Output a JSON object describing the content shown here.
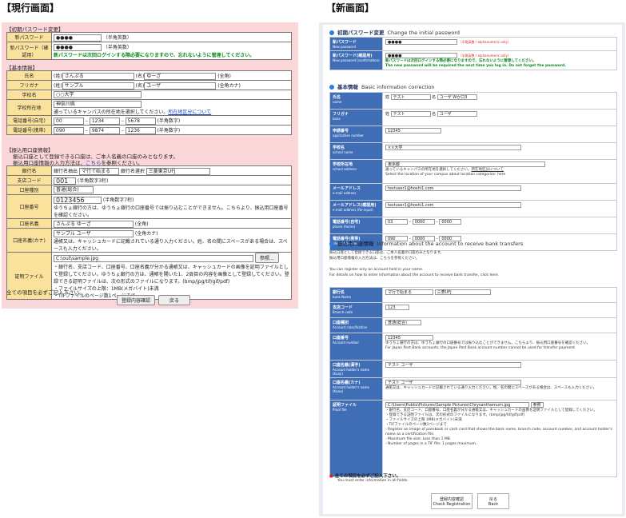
{
  "left_header": "【現行画面】",
  "right_header": "【新画面】",
  "old": {
    "sec1": "【初期パスワード変更】",
    "pw_label": "新パスワード",
    "pw_value": "●●●●",
    "pw_hint": "（半角英数）",
    "pw2_label": "新パスワード（確認用）",
    "pw2_value": "●●●●",
    "pw2_hint": "（半角英数）",
    "pw_note": "新パスワードは次回ログインする際必要になりますので、忘れないように管理してください。",
    "sec2": "【基本情報】",
    "name_label": "氏名",
    "sei_l": "(姓)",
    "sei": "さんぷる",
    "mei_l": "(名)",
    "mei": "ゆーざ",
    "zen": "(全角)",
    "kana_label": "フリガナ",
    "kana_sei": "サンプル",
    "kana_mei": "ユーザ",
    "zenkana": "(全角カナ)",
    "school_label": "学校名",
    "school": "○○大学",
    "campus_label": "学校所在地",
    "campus": "神奈川県",
    "campus_note": "通っているキャンパスの所在地を選択してください。",
    "campus_link": "所在地区分について",
    "tel_label": "電話番号(自宅)",
    "tel": [
      "00",
      "1234",
      "5678"
    ],
    "han": "(半角数字)",
    "mob_label": "電話番号(携帯)",
    "mob": [
      "090",
      "9874",
      "1236"
    ],
    "sec3": "【振込用口座情報】",
    "bank_note1": "振込口座として登録できる口座は、ご本人名義の口座のみとなります。",
    "bank_note2": "振込用口座情報の入力方法は、",
    "bank_note2_link": "こちら",
    "bank_note2_end": "を参照ください。",
    "bank_label": "銀行名",
    "bank_filter_l": "銀行名抽出",
    "bank_filter": "マ行で始まる",
    "bank_sel_l": "銀行名選択",
    "bank_sel": "三菱東京UFJ",
    "branch_label": "支店コード",
    "branch": "001",
    "branch_hint": "(半角数字3桁)",
    "type_label": "口座種別",
    "type": "普通(総合)",
    "acct_label": "口座番号",
    "acct": "0123456",
    "acct_hint": "(半角数字7桁)",
    "acct_note": "ゆうちょ銀行の方は、ゆうちょ銀行の口座番号では振り込むことができません。こちらより、振込用口座番号を確認ください。",
    "holder_label": "口座名義",
    "holder": "さんぷる ゆーざ",
    "holder_hint": "(全角)",
    "holder_kana_label": "口座名義(カナ)",
    "holder_kana": "サンプル ユーザ",
    "holder_kana_hint": "(全角カナ)",
    "holder_kana_note": "通帳又は、キャッシュカードに記載されている通り入力ください。姓、名の間にスペースがある場合は、スペースも入力ください。",
    "proof_label": "証明ファイル",
    "proof": "C:\\out\\sample.jpg",
    "browse": "参照...",
    "proof_note1": "・銀行名、支店コード、口座番号、口座名義が分かる通帳又は、キャッシュカードの画像を証明ファイルとして登録してください。ゆうちょ銀行の方は、通帳を開いた1、2頁目の内容を画像として登録してください。登録できる証明ファイルは、次の形式のファイルになります。(bmp/jpg/tif/gif/pdf)",
    "proof_note2": "・ファイルサイズの上限：1MB(メガバイト)未満",
    "proof_note3": "・TIFファイルのページ数1ページまで",
    "all_required": "全ての項目を必ずご記入下さい。",
    "confirm_btn": "登録内容確認",
    "back_btn": "戻る"
  },
  "new": {
    "s1": "初期パスワード変更",
    "s1_en": "Change the initial password",
    "npw": "新パスワード",
    "npw_en": "New password",
    "npw_v": "●●●●",
    "npw_h": "（半角英数 / alphanumeric only）",
    "npw2": "新パスワード(確認用)",
    "npw2_en": "New password (confirmation)",
    "npw2_v": "●●●●",
    "npw_note": "新パスワードは次回ログインする際必要になりますので、忘れないように管理してください。",
    "npw_note_en": "The new password will be required the next time you log in. Do not forget the password.",
    "s2": "基本情報",
    "s2_en": "Basic information correction",
    "nm": "氏名",
    "nm_en": "name",
    "nm_sei": "テスト",
    "nm_mei": "ユーザ Wか口3",
    "kn": "フリガナ",
    "kn_en": "kana",
    "kn_sei": "テスト",
    "kn_mei": "ユーザ",
    "app": "申請番号",
    "app_en": "application number",
    "app_v": "12345",
    "sch": "学校名",
    "sch_en": "school name",
    "sch_v": "××大学",
    "adr": "学校所在地",
    "adr_en": "school address",
    "adr_v": "東京都",
    "adr_note": "通っているキャンパスの所在地を選択してください。",
    "adr_link": "所在地区分について",
    "adr_note_en": "Select the location of your campus about location categories: here",
    "mail": "メールアドレス",
    "mail_en": "e-mail address",
    "mail_v": "testuser1@hoshi1.com",
    "mail2": "メールアドレス(確認用)",
    "mail2_en": "e-mail address (Re-input)",
    "mail2_v": "testuser1@hoshi1.com",
    "tel": "電話番号(自宅)",
    "tel_en": "phone (home)",
    "tel_v": [
      "03",
      "0000",
      "0000"
    ],
    "mob": "電話番号(携帯)",
    "mob_en": "phone (mobile)",
    "mob_v": [
      "090",
      "0000",
      "0000"
    ],
    "s3": "振込用口座情報",
    "s3_en": "Information about the account to receive bank transfers",
    "b_note1": "振込口座として登録できる口座は、ご本人名義の口座のみとなります。",
    "b_note2": "振込用口座情報の入力方法は、こちらを参照ください。",
    "b_note3": "You can register only an account held in your name.",
    "b_note4": "For details on how to enter information about the account to receive bank transfer, click here.",
    "bk": "銀行名",
    "bk_en": "bank Name",
    "bk_f": "マ行で始まる",
    "bk_s": "三菱UFJ",
    "br": "支店コード",
    "br_en": "Branch code",
    "br_v": "123",
    "ty": "口座種別",
    "ty_en": "Account classification",
    "ty_v": "普通(総合)",
    "ac": "口座番号",
    "ac_en": "Account number",
    "ac_v": "12345",
    "ac_note": "ゆうちょ銀行の方は、ゆうちょ銀行の口座番号では振り込むことができません。こちらより、振込用口座番号を確認ください。",
    "ac_note_en": "For Japan Post Bank accounts, the Japan Post Bank account number cannot be used for transfer payment.",
    "ho": "口座名義(漢字)",
    "ho_en": "Account holder's name (Kanji)",
    "ho_v": "テスト ユーザ",
    "hk": "口座名義(カナ)",
    "hk_en": "Account holder's name (Kana)",
    "hk_v": "テスト ユーザ",
    "hk_note": "通帳又は、キャッシュカードに記載されている通り入力ください。姓、名の間にスペースがある場合は、スペースも入力ください。",
    "pf": "証明ファイル",
    "pf_en": "Proof file",
    "pf_v": "C:\\Users\\Public\\Pictures\\Sample Pictures\\Chrysanthemum.jpg",
    "pf_btn": "参照",
    "pf_note1": "・銀行名、支店コード、口座番号、口座名義が分かる通帳又は、キャッシュカードの画像を証明ファイルとして登録してください。",
    "pf_note2": "・登録できる証明ファイルは、次の形式のファイルになります。(bmp/jpg/tif/gif/pdf)",
    "pf_note3": "・ファイルサイズの上限 1MB(メガバイト)未満",
    "pf_note4": "・TIFファイルのページ数1ページまで",
    "pf_note_en1": "- Register an image of passbook or cash card that shows the bank name, branch code, account number, and account holder's name as a certification file.",
    "pf_note_en2": "- Maximum file size: Less than 1 MB",
    "pf_note_en3": "- Number of pages in a TIF file: 1 pages maximum.",
    "req": "全ての項目を必ずご記入下さい。",
    "req_en": "You must enter information in all fields.",
    "btn1": "登録内容確認",
    "btn1_en": "Check Registration",
    "btn2": "戻る",
    "btn2_en": "Back"
  }
}
